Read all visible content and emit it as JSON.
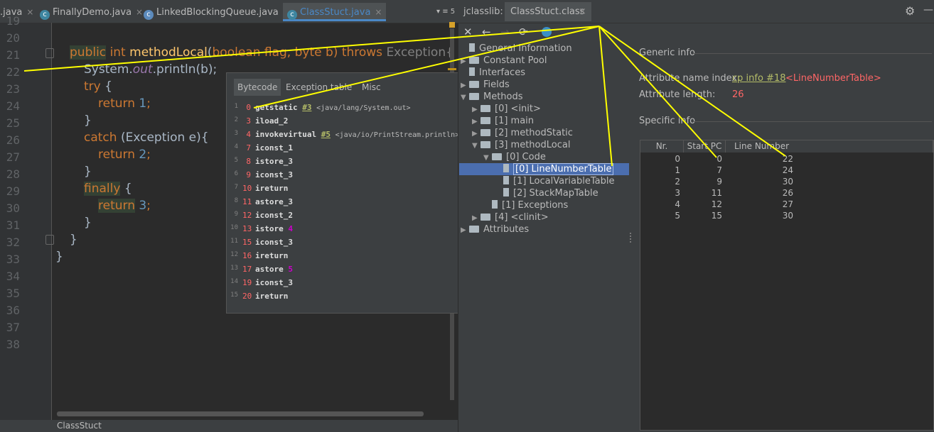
{
  "editor": {
    "tabs": [
      {
        "label": ".java",
        "close": "×"
      },
      {
        "label": "FinallyDemo.java",
        "close": "×"
      },
      {
        "label": "LinkedBlockingQueue.java",
        "close": "×"
      },
      {
        "label": "ClassStuct.java",
        "close": "×"
      }
    ],
    "tab_overflow": "▾ ≡ 5",
    "line_numbers": [
      "19",
      "20",
      "21",
      "22",
      "23",
      "24",
      "25",
      "26",
      "27",
      "28",
      "29",
      "30",
      "31",
      "32",
      "33",
      "34",
      "35",
      "36",
      "37",
      "38"
    ],
    "code": {
      "l21_public": "public",
      "l21_int": "int",
      "l21_method": "methodLocal",
      "l21_paren": "(",
      "l21_params": "boolean flag, byte b)",
      "l21_throws": "throws",
      "l21_exc": "Exception{",
      "l22_system": "System.",
      "l22_out": "out",
      "l22_rest": ".println(b);",
      "l23_try": "try",
      "l23_brace": "{",
      "l24_return": "return",
      "l24_val": "1",
      "l24_semi": ";",
      "l25": "}",
      "l26_catch": "catch",
      "l26_rest": "(Exception e){",
      "l27_return": "return",
      "l27_val": "2",
      "l27_semi": ";",
      "l28": "}",
      "l29_finally": "finally",
      "l29_brace": "{",
      "l30_return": "return",
      "l30_val": "3",
      "l30_semi": ";",
      "l31": "}",
      "l32": "}",
      "l33": "}"
    },
    "status_text": "ClassStuct"
  },
  "bytecode_popup": {
    "tabs": [
      "Bytecode",
      "Exception table",
      "Misc"
    ],
    "rows": [
      {
        "idx": "1",
        "pc": "0",
        "op": "getstatic",
        "ref": "#3",
        "comment": "<java/lang/System.out>",
        "arg": ""
      },
      {
        "idx": "2",
        "pc": "3",
        "op": "iload_2",
        "ref": "",
        "comment": "",
        "arg": ""
      },
      {
        "idx": "3",
        "pc": "4",
        "op": "invokevirtual",
        "ref": "#5",
        "comment": "<java/io/PrintStream.println>",
        "arg": ""
      },
      {
        "idx": "4",
        "pc": "7",
        "op": "iconst_1",
        "ref": "",
        "comment": "",
        "arg": ""
      },
      {
        "idx": "5",
        "pc": "8",
        "op": "istore_3",
        "ref": "",
        "comment": "",
        "arg": ""
      },
      {
        "idx": "6",
        "pc": "9",
        "op": "iconst_3",
        "ref": "",
        "comment": "",
        "arg": ""
      },
      {
        "idx": "7",
        "pc": "10",
        "op": "ireturn",
        "ref": "",
        "comment": "",
        "arg": ""
      },
      {
        "idx": "8",
        "pc": "11",
        "op": "astore_3",
        "ref": "",
        "comment": "",
        "arg": ""
      },
      {
        "idx": "9",
        "pc": "12",
        "op": "iconst_2",
        "ref": "",
        "comment": "",
        "arg": ""
      },
      {
        "idx": "10",
        "pc": "13",
        "op": "istore",
        "ref": "",
        "comment": "",
        "arg": "4"
      },
      {
        "idx": "11",
        "pc": "15",
        "op": "iconst_3",
        "ref": "",
        "comment": "",
        "arg": ""
      },
      {
        "idx": "12",
        "pc": "16",
        "op": "ireturn",
        "ref": "",
        "comment": "",
        "arg": ""
      },
      {
        "idx": "13",
        "pc": "17",
        "op": "astore",
        "ref": "",
        "comment": "",
        "arg": "5"
      },
      {
        "idx": "14",
        "pc": "19",
        "op": "iconst_3",
        "ref": "",
        "comment": "",
        "arg": ""
      },
      {
        "idx": "15",
        "pc": "20",
        "op": "ireturn",
        "ref": "",
        "comment": "",
        "arg": ""
      }
    ]
  },
  "jclasslib": {
    "title": "jclasslib:",
    "tab_label": "ClassStuct.class",
    "tab_close": "×",
    "toolbar": {
      "close": "✕",
      "back": "←",
      "forward": "→",
      "refresh": "⟳"
    },
    "tree": [
      {
        "label": "General Information",
        "indent": 0,
        "arrow": "",
        "kind": "file"
      },
      {
        "label": "Constant Pool",
        "indent": 0,
        "arrow": "▶",
        "kind": "folder"
      },
      {
        "label": "Interfaces",
        "indent": 0,
        "arrow": "",
        "kind": "file"
      },
      {
        "label": "Fields",
        "indent": 0,
        "arrow": "▶",
        "kind": "folder"
      },
      {
        "label": "Methods",
        "indent": 0,
        "arrow": "▼",
        "kind": "folder"
      },
      {
        "label": "[0] <init>",
        "indent": 1,
        "arrow": "▶",
        "kind": "folder"
      },
      {
        "label": "[1] main",
        "indent": 1,
        "arrow": "▶",
        "kind": "folder"
      },
      {
        "label": "[2] methodStatic",
        "indent": 1,
        "arrow": "▶",
        "kind": "folder"
      },
      {
        "label": "[3] methodLocal",
        "indent": 1,
        "arrow": "▼",
        "kind": "folder"
      },
      {
        "label": "[0] Code",
        "indent": 2,
        "arrow": "▼",
        "kind": "folder"
      },
      {
        "label": "[0] LineNumberTable",
        "indent": 3,
        "arrow": "",
        "kind": "file",
        "selected": true
      },
      {
        "label": "[1] LocalVariableTable",
        "indent": 3,
        "arrow": "",
        "kind": "file"
      },
      {
        "label": "[2] StackMapTable",
        "indent": 3,
        "arrow": "",
        "kind": "file"
      },
      {
        "label": "[1] Exceptions",
        "indent": 2,
        "arrow": "",
        "kind": "file"
      },
      {
        "label": "[4] <clinit>",
        "indent": 1,
        "arrow": "▶",
        "kind": "folder"
      },
      {
        "label": "Attributes",
        "indent": 0,
        "arrow": "▶",
        "kind": "folder"
      }
    ],
    "generic_info": {
      "heading": "Generic info",
      "name_index_label": "Attribute name index:",
      "name_index_link": "cp info #18",
      "name_index_value": "<LineNumberTable>",
      "length_label": "Attribute length:",
      "length_value": "26"
    },
    "specific_info": {
      "heading": "Specific info",
      "columns": [
        "Nr.",
        "Start PC",
        "Line Number"
      ],
      "rows": [
        [
          "0",
          "0",
          "22"
        ],
        [
          "1",
          "7",
          "24"
        ],
        [
          "2",
          "9",
          "30"
        ],
        [
          "3",
          "11",
          "26"
        ],
        [
          "4",
          "12",
          "27"
        ],
        [
          "5",
          "15",
          "30"
        ]
      ]
    }
  },
  "colors": {
    "annotation": "#ffff00",
    "selection": "#4b6eaf",
    "link": "#b5bd68",
    "value_red": "#ff6666"
  }
}
